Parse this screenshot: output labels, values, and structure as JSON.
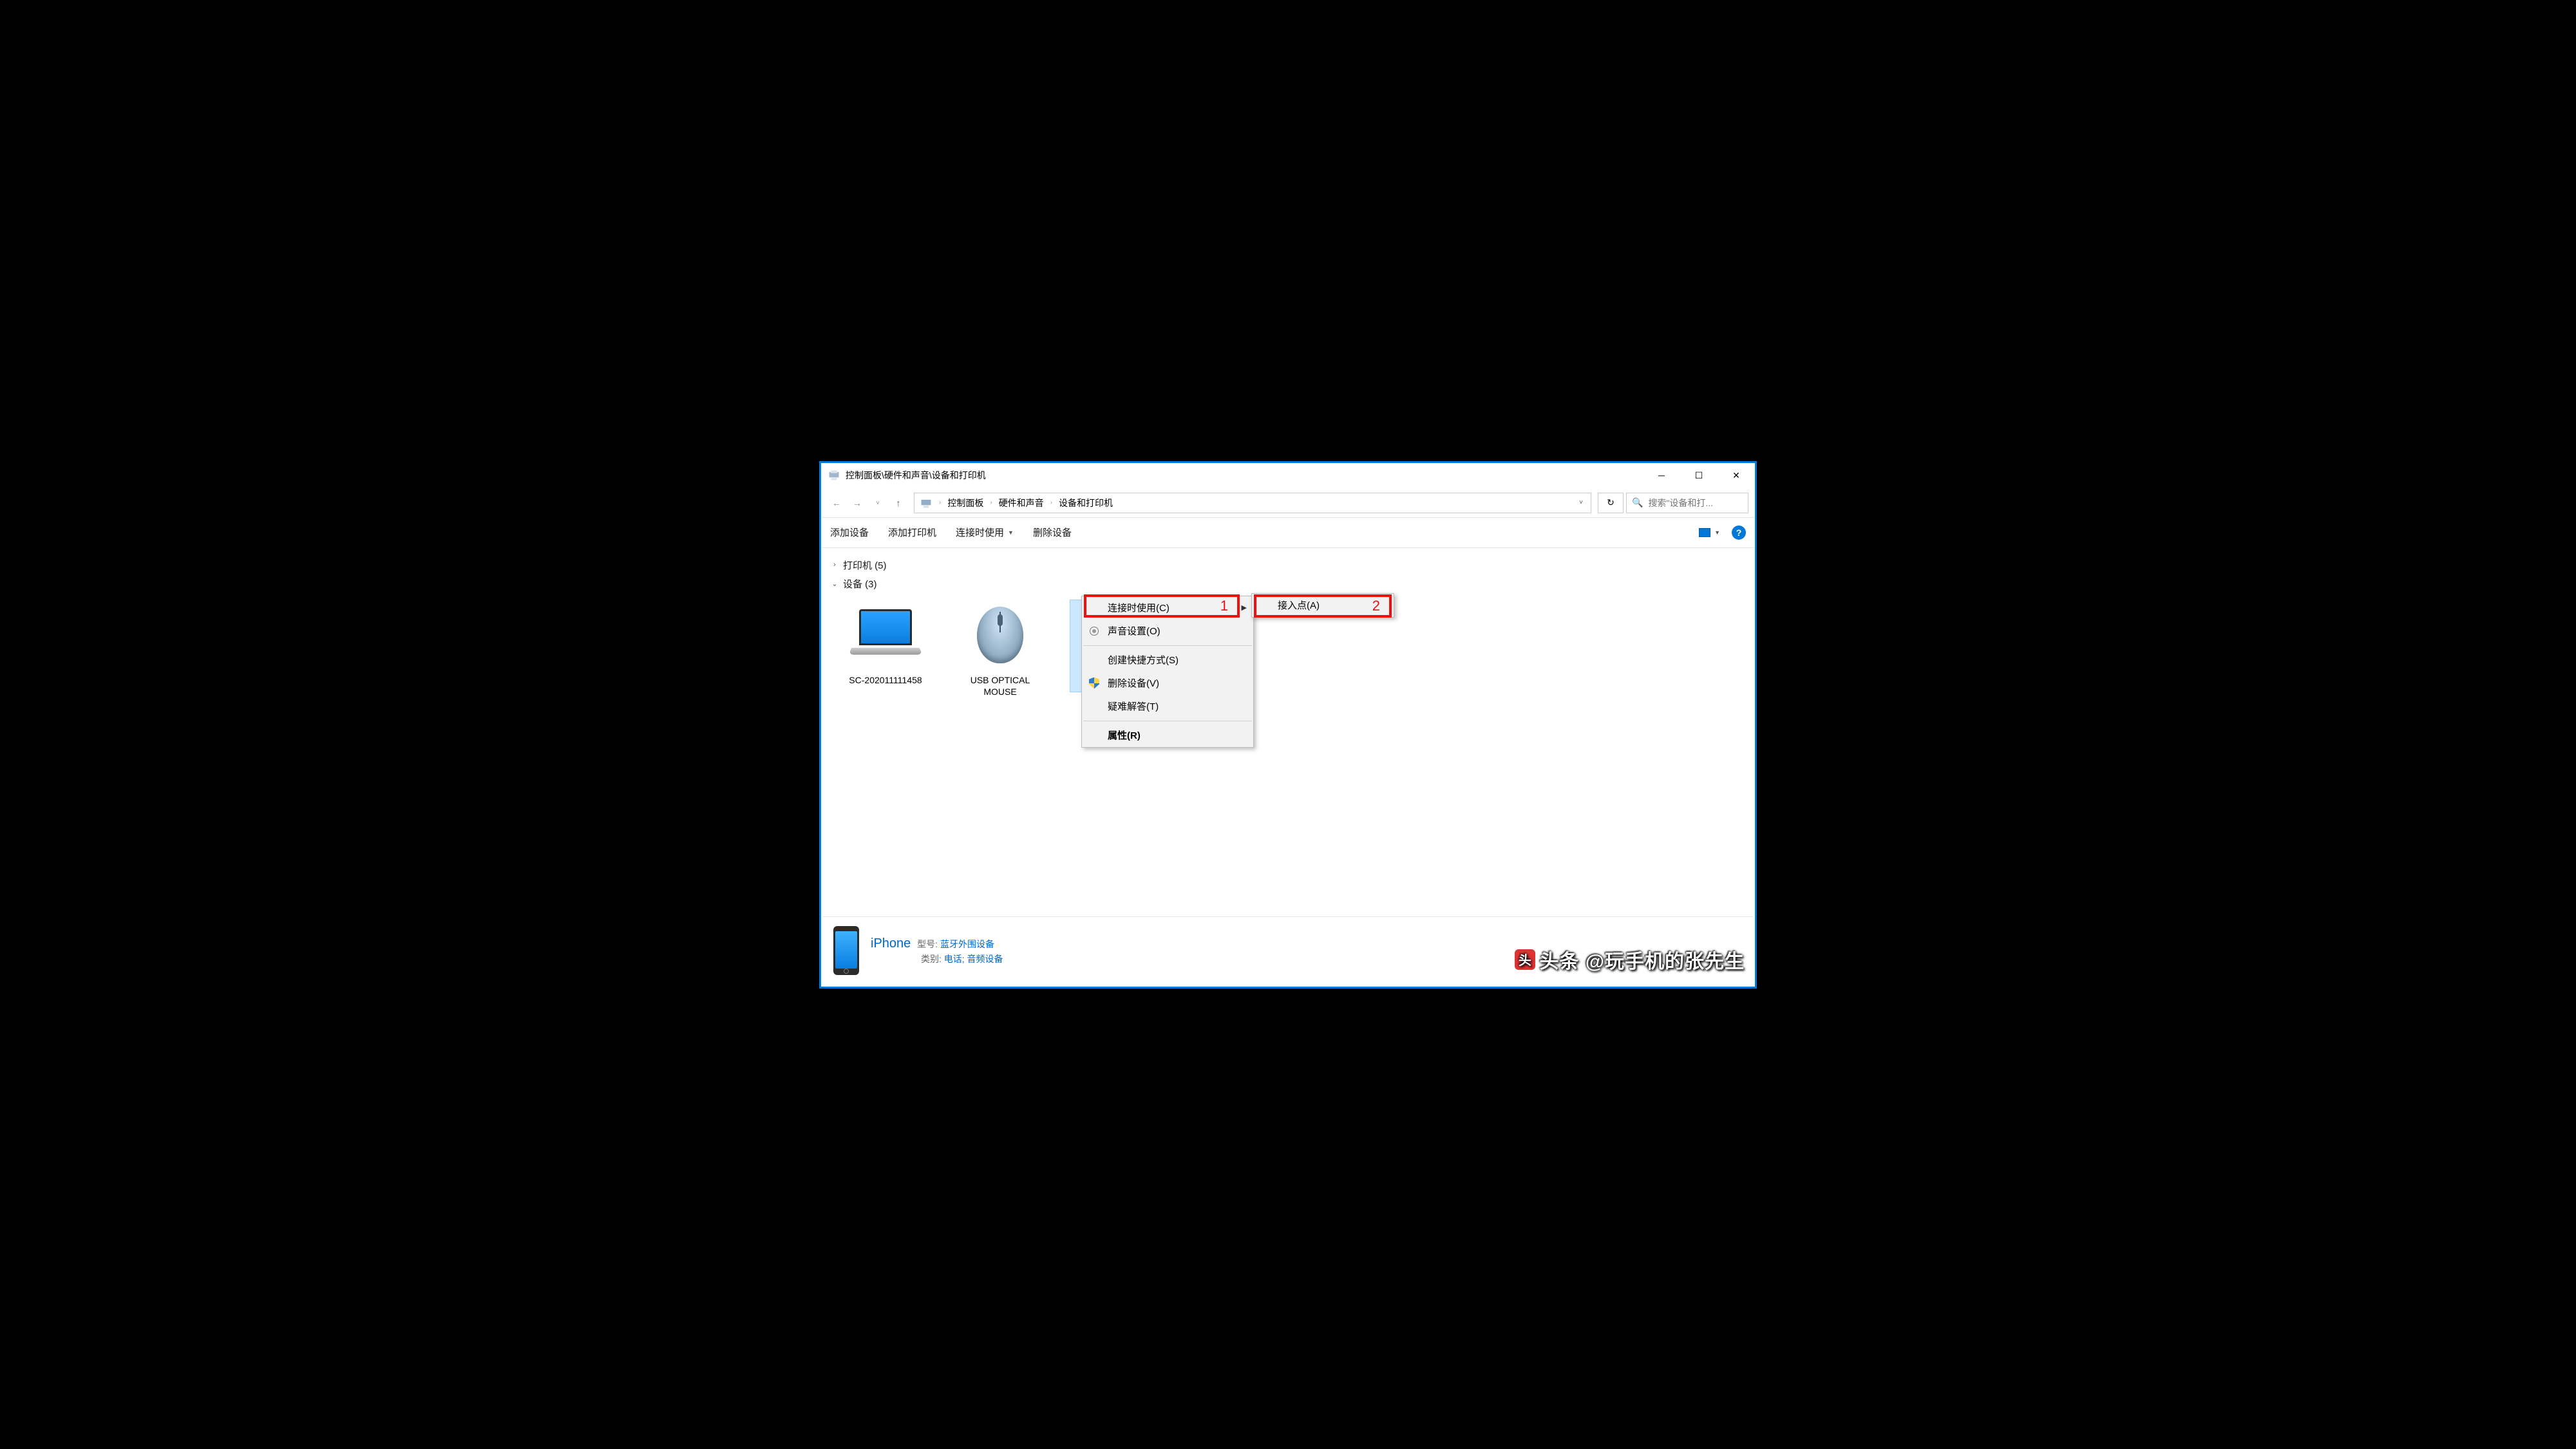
{
  "window": {
    "title": "控制面板\\硬件和声音\\设备和打印机"
  },
  "breadcrumb": {
    "items": [
      "控制面板",
      "硬件和声音",
      "设备和打印机"
    ]
  },
  "search": {
    "placeholder": "搜索\"设备和打..."
  },
  "toolbar": {
    "add_device": "添加设备",
    "add_printer": "添加打印机",
    "connect_using": "连接时使用",
    "remove_device": "删除设备"
  },
  "groups": {
    "printers": {
      "label": "打印机 (5)",
      "expanded": false
    },
    "devices": {
      "label": "设备 (3)",
      "expanded": true
    }
  },
  "devices": [
    {
      "name": "SC-202011111458"
    },
    {
      "name": "USB OPTICAL MOUSE"
    },
    {
      "name": "iPhone"
    }
  ],
  "context_menu": {
    "connect_using": "连接时使用(C)",
    "sound_settings": "声音设置(O)",
    "create_shortcut": "创建快捷方式(S)",
    "remove_device": "删除设备(V)",
    "troubleshoot": "疑难解答(T)",
    "properties": "属性(R)"
  },
  "submenu": {
    "access_point": "接入点(A)"
  },
  "annotations": {
    "n1": "1",
    "n2": "2"
  },
  "details": {
    "name": "iPhone",
    "model_label": "型号:",
    "model_value": "蓝牙外围设备",
    "category_label": "类别:",
    "category_value": "电话; 音频设备"
  },
  "watermark": {
    "text": "头条 @玩手机的张先生"
  }
}
